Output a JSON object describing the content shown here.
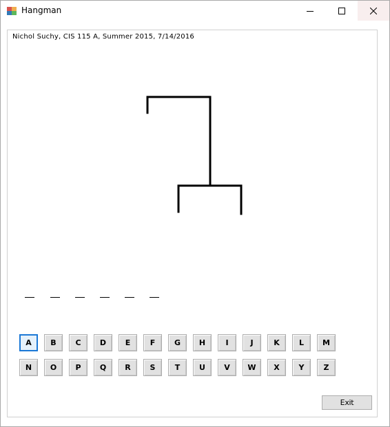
{
  "window": {
    "title": "Hangman"
  },
  "caption": "Nichol Suchy, CIS 115 A, Summer 2015, 7/14/2016",
  "word_blanks": [
    "",
    "",
    "",
    "",
    "",
    ""
  ],
  "letters_row1": [
    "A",
    "B",
    "C",
    "D",
    "E",
    "F",
    "G",
    "H",
    "I",
    "J",
    "K",
    "L",
    "M"
  ],
  "letters_row2": [
    "N",
    "O",
    "P",
    "Q",
    "R",
    "S",
    "T",
    "U",
    "V",
    "W",
    "X",
    "Y",
    "Z"
  ],
  "focused_letter": "A",
  "exit_label": "Exit"
}
